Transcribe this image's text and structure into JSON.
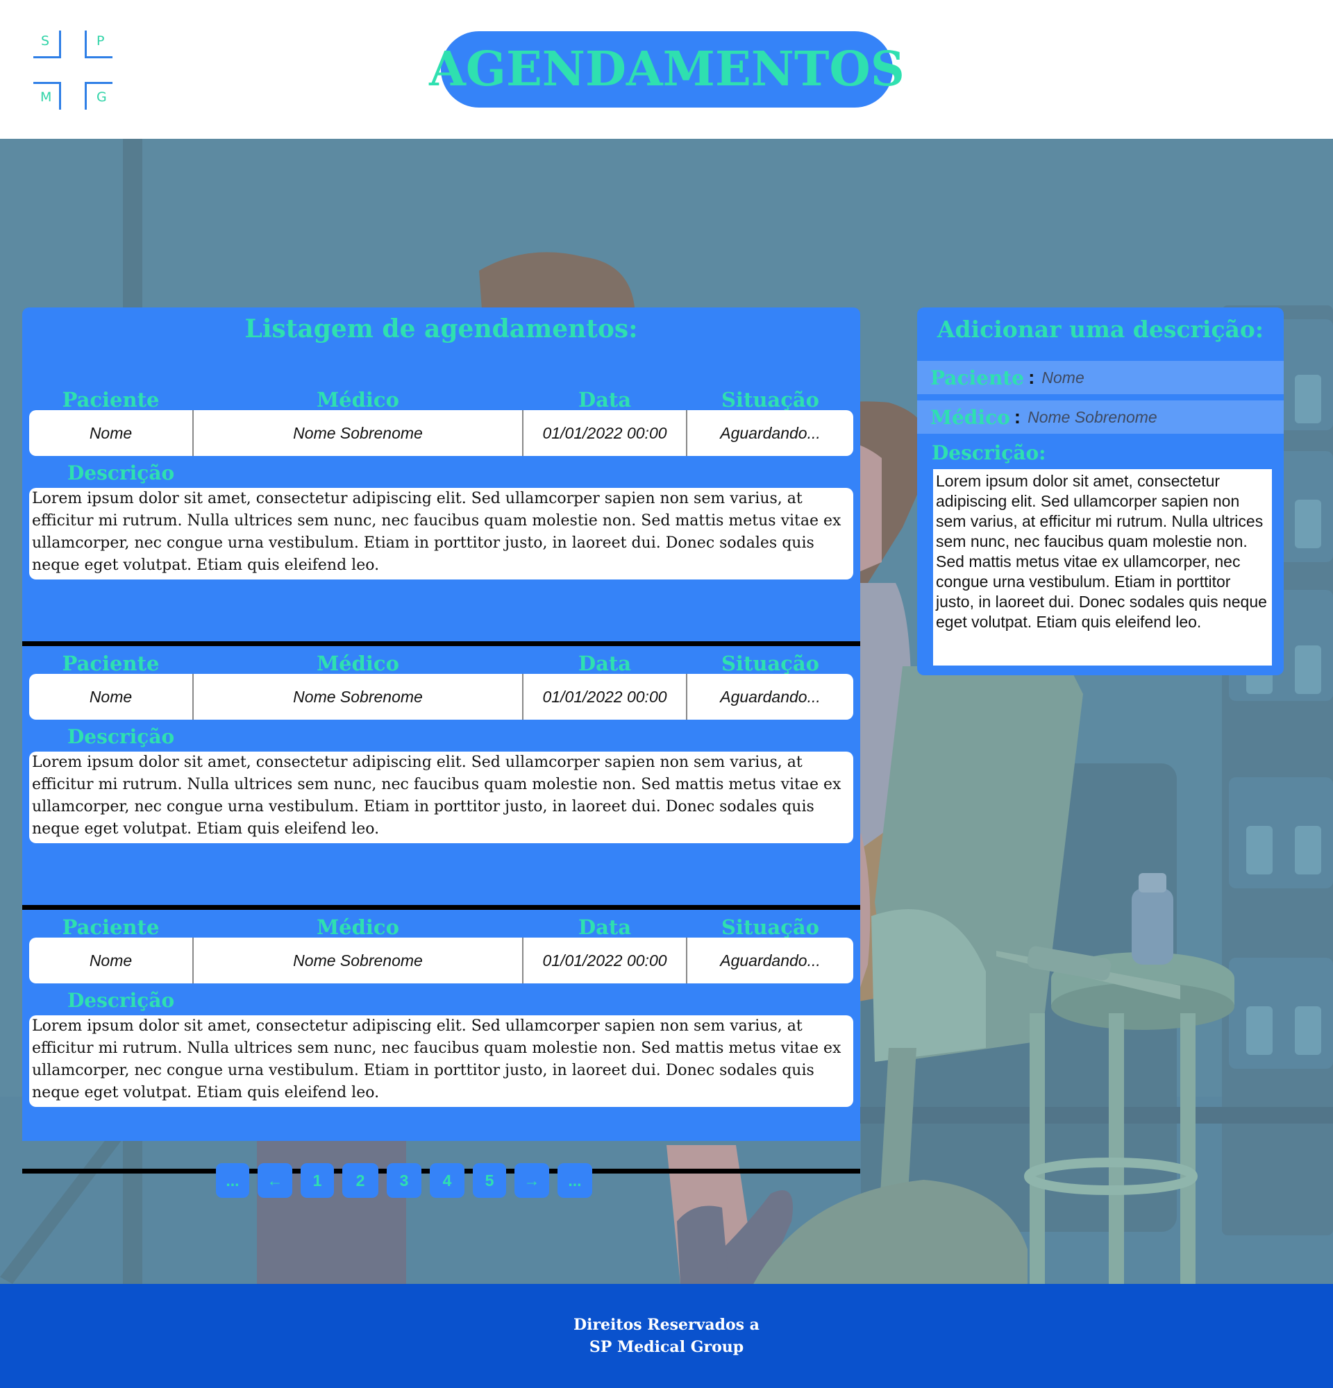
{
  "logo": {
    "letters": [
      "S",
      "P",
      "M",
      "G"
    ]
  },
  "header": {
    "title": "AGENDAMENTOS"
  },
  "list": {
    "title": "Listagem de agendamentos:",
    "column_headers": [
      "Paciente",
      "Médico",
      "Data",
      "Situação"
    ],
    "description_label": "Descrição",
    "entries": [
      {
        "paciente": "Nome",
        "medico": "Nome Sobrenome",
        "data": "01/01/2022 00:00",
        "situacao": "Aguardando...",
        "descricao": "Lorem ipsum dolor sit amet, consectetur adipiscing elit. Sed ullamcorper sapien non sem varius, at efficitur mi rutrum. Nulla ultrices sem nunc, nec faucibus quam molestie non. Sed mattis metus vitae ex ullamcorper, nec congue urna vestibulum. Etiam in porttitor justo, in laoreet dui. Donec sodales quis neque eget volutpat. Etiam quis eleifend leo."
      },
      {
        "paciente": "Nome",
        "medico": "Nome Sobrenome",
        "data": "01/01/2022 00:00",
        "situacao": "Aguardando...",
        "descricao": "Lorem ipsum dolor sit amet, consectetur adipiscing elit. Sed ullamcorper sapien non sem varius, at efficitur mi rutrum. Nulla ultrices sem nunc, nec faucibus quam molestie non. Sed mattis metus vitae ex ullamcorper, nec congue urna vestibulum. Etiam in porttitor justo, in laoreet dui. Donec sodales quis neque eget volutpat. Etiam quis eleifend leo."
      },
      {
        "paciente": "Nome",
        "medico": "Nome Sobrenome",
        "data": "01/01/2022 00:00",
        "situacao": "Aguardando...",
        "descricao": "Lorem ipsum dolor sit amet, consectetur adipiscing elit. Sed ullamcorper sapien non sem varius, at efficitur mi rutrum. Nulla ultrices sem nunc, nec faucibus quam molestie non. Sed mattis metus vitae ex ullamcorper, nec congue urna vestibulum. Etiam in porttitor justo, in laoreet dui. Donec sodales quis neque eget volutpat. Etiam quis eleifend leo."
      }
    ]
  },
  "pagination": {
    "items": [
      "...",
      "←",
      "1",
      "2",
      "3",
      "4",
      "5",
      "→",
      "..."
    ]
  },
  "side": {
    "title": "Adicionar uma descrição:",
    "paciente_label": "Paciente",
    "paciente_placeholder": "Nome",
    "medico_label": "Médico",
    "medico_placeholder": "Nome Sobrenome",
    "colon": ":",
    "descricao_label": "Descrição:",
    "descricao_text": "Lorem ipsum dolor sit amet, consectetur adipiscing elit. Sed ullamcorper sapien non sem varius, at efficitur mi rutrum. Nulla ultrices sem nunc, nec faucibus quam molestie non. Sed mattis metus vitae ex ullamcorper, nec congue urna vestibulum. Etiam in porttitor justo, in laoreet dui. Donec sodales quis neque eget volutpat. Etiam quis eleifend leo."
  },
  "footer": {
    "line1": "Direitos Reservados a",
    "line2": "SP Medical Group"
  },
  "colors": {
    "panel_blue": "#3583f8",
    "accent_green": "#2fe0b0",
    "footer_blue": "#0a52cd",
    "scene_background": "#5d8aa1"
  }
}
